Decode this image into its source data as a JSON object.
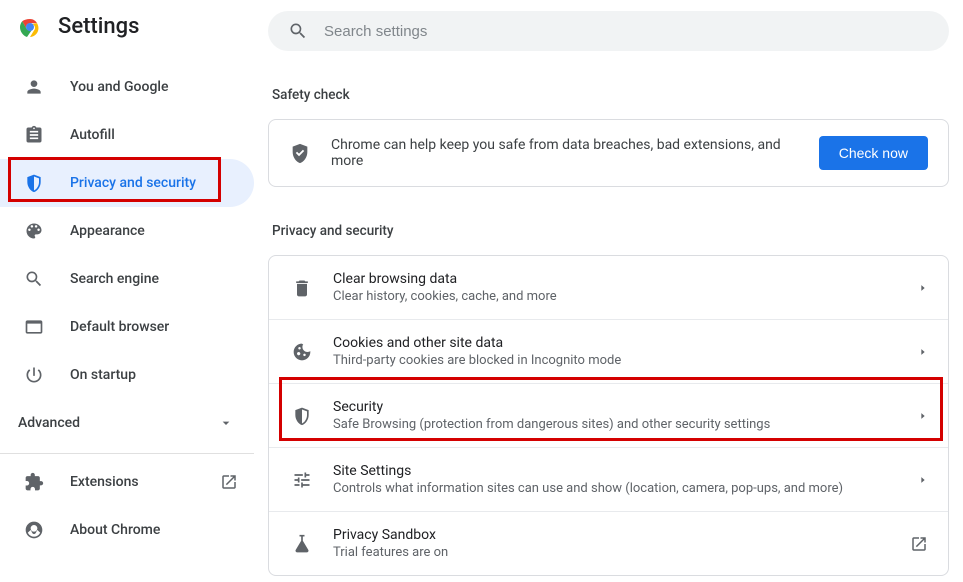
{
  "brand": {
    "title": "Settings"
  },
  "search": {
    "placeholder": "Search settings"
  },
  "sidebar": {
    "items": [
      {
        "label": "You and Google"
      },
      {
        "label": "Autofill"
      },
      {
        "label": "Privacy and security"
      },
      {
        "label": "Appearance"
      },
      {
        "label": "Search engine"
      },
      {
        "label": "Default browser"
      },
      {
        "label": "On startup"
      }
    ],
    "advanced": "Advanced",
    "footer": [
      {
        "label": "Extensions"
      },
      {
        "label": "About Chrome"
      }
    ]
  },
  "safety": {
    "heading": "Safety check",
    "text": "Chrome can help keep you safe from data breaches, bad extensions, and more",
    "button": "Check now"
  },
  "privacy": {
    "heading": "Privacy and security",
    "rows": [
      {
        "title": "Clear browsing data",
        "sub": "Clear history, cookies, cache, and more"
      },
      {
        "title": "Cookies and other site data",
        "sub": "Third-party cookies are blocked in Incognito mode"
      },
      {
        "title": "Security",
        "sub": "Safe Browsing (protection from dangerous sites) and other security settings"
      },
      {
        "title": "Site Settings",
        "sub": "Controls what information sites can use and show (location, camera, pop-ups, and more)"
      },
      {
        "title": "Privacy Sandbox",
        "sub": "Trial features are on"
      }
    ]
  },
  "icons": {
    "chrome": "chrome-logo"
  }
}
